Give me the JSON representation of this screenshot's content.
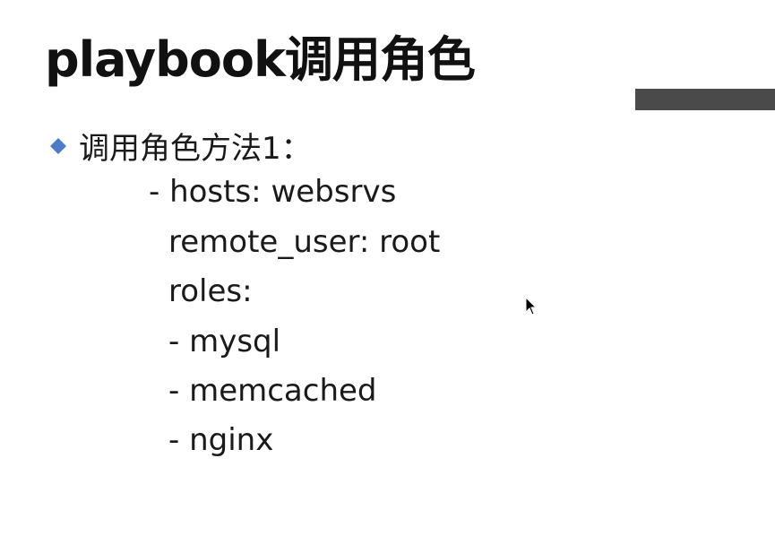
{
  "slide": {
    "title": "playbook调用角色",
    "bullet": {
      "icon": "diamond-bullet-icon",
      "color": "#4a7cc7",
      "text": "调用角色方法1："
    },
    "code_lines": [
      "- hosts: websrvs",
      "remote_user: root",
      "roles:",
      "- mysql",
      "- memcached",
      "- nginx"
    ],
    "accent_bar_color": "#4a4a4a"
  }
}
